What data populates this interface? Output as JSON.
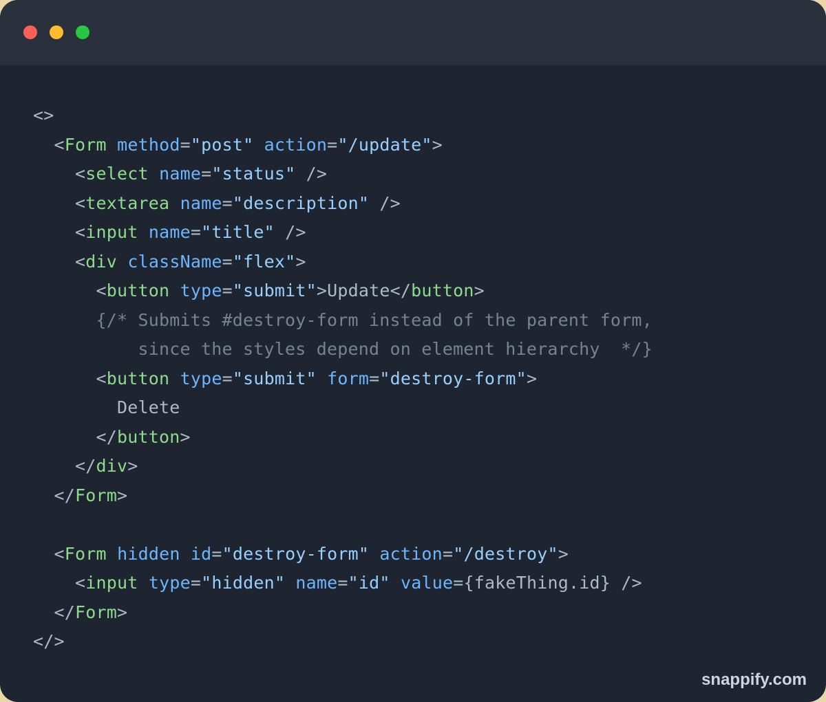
{
  "code": {
    "l1": {
      "open": "<>",
      "close": ""
    },
    "l2": {
      "tag": "Form",
      "attr_method": "method",
      "val_method": "\"post\"",
      "attr_action": "action",
      "val_action": "\"/update\""
    },
    "l3": {
      "tag": "select",
      "attr_name": "name",
      "val_name": "\"status\""
    },
    "l4": {
      "tag": "textarea",
      "attr_name": "name",
      "val_name": "\"description\""
    },
    "l5": {
      "tag": "input",
      "attr_name": "name",
      "val_name": "\"title\""
    },
    "l6": {
      "tag": "div",
      "attr_class": "className",
      "val_class": "\"flex\""
    },
    "l7": {
      "tag": "button",
      "attr_type": "type",
      "val_type": "\"submit\"",
      "text": "Update",
      "close_tag": "button"
    },
    "l8": {
      "comment_open": "{/* ",
      "comment_body": "Submits #destroy-form instead of the parent form,"
    },
    "l9": {
      "comment_body": "since the styles depend on element hierarchy  ",
      "comment_close": "*/}"
    },
    "l10": {
      "tag": "button",
      "attr_type": "type",
      "val_type": "\"submit\"",
      "attr_form": "form",
      "val_form": "\"destroy-form\""
    },
    "l11": {
      "text": "Delete"
    },
    "l12": {
      "close_tag": "button"
    },
    "l13": {
      "close_tag": "div"
    },
    "l14": {
      "close_tag": "Form"
    },
    "l16": {
      "tag": "Form",
      "attr_hidden": "hidden",
      "attr_id": "id",
      "val_id": "\"destroy-form\"",
      "attr_action": "action",
      "val_action": "\"/destroy\""
    },
    "l17": {
      "tag": "input",
      "attr_type": "type",
      "val_type": "\"hidden\"",
      "attr_name": "name",
      "val_name": "\"id\"",
      "attr_value": "value",
      "expr_value": "{fakeThing.id}"
    },
    "l18": {
      "close_tag": "Form"
    },
    "l19": {
      "close": "</>"
    }
  },
  "watermark": "snappify.com"
}
